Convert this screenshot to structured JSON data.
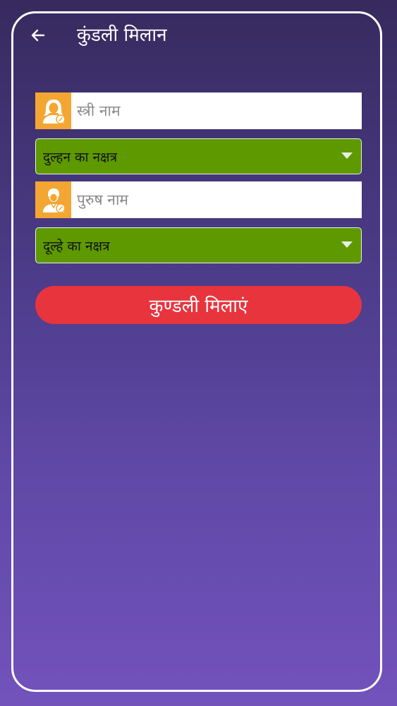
{
  "header": {
    "title": "कुंडली मिलान",
    "back_icon": "arrow-left-icon"
  },
  "bride": {
    "name_placeholder": "स्त्री नाम",
    "name_value": "",
    "icon": "female-user-icon",
    "nakshatra_selected": "दुल्हन का नक्षत्र"
  },
  "groom": {
    "name_placeholder": "पुरुष नाम",
    "name_value": "",
    "icon": "male-user-icon",
    "nakshatra_selected": "दूल्हे का नक्षत्र"
  },
  "actions": {
    "match_label": "कुण्डली मिलाएं"
  },
  "colors": {
    "icon_bg": "#f3a632",
    "select_bg": "#5e9900",
    "button_bg": "#e8343d",
    "frame": "#ffffff"
  }
}
